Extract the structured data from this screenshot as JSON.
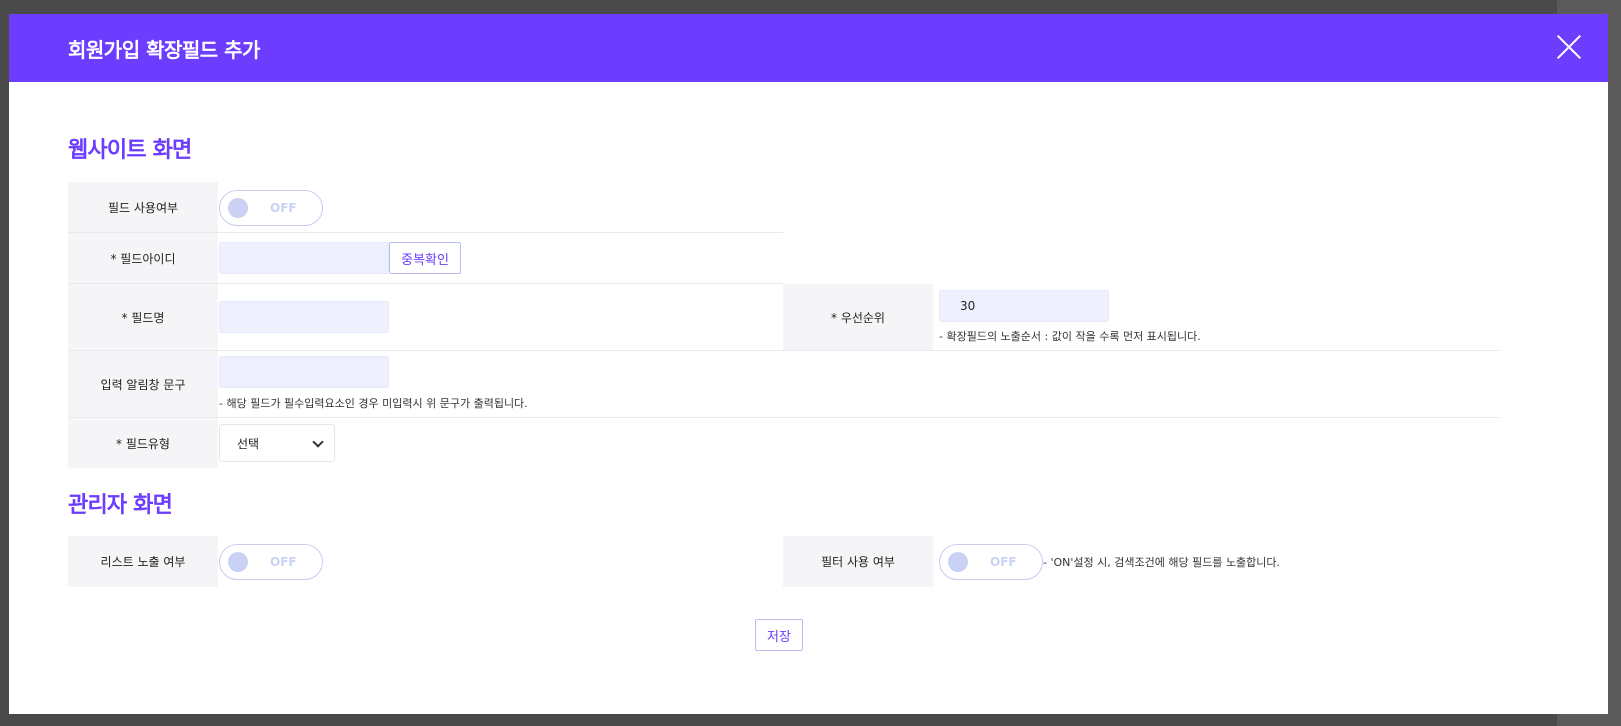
{
  "modal": {
    "title": "회원가입 확장필드 추가"
  },
  "website_section": {
    "title": "웹사이트 화면",
    "field_use": {
      "label": "필드 사용여부",
      "toggle": "OFF"
    },
    "field_id": {
      "label": "* 필드아이디",
      "value": "",
      "check_button": "중복확인"
    },
    "field_name": {
      "label": "* 필드명",
      "value": ""
    },
    "priority": {
      "label": "* 우선순위",
      "value": "30",
      "hint": "- 확장필드의 노출순서 : 값이 작을 수록 먼저 표시됩니다."
    },
    "alert_text": {
      "label": "입력 알림창 문구",
      "value": "",
      "hint": "- 해당 필드가 필수입력요소인 경우 미입력시 위 문구가 출력됩니다."
    },
    "field_type": {
      "label": "* 필드유형",
      "selected": "선택"
    }
  },
  "admin_section": {
    "title": "관리자 화면",
    "list_display": {
      "label": "리스트 노출 여부",
      "toggle": "OFF"
    },
    "filter_use": {
      "label": "필터 사용 여부",
      "toggle": "OFF",
      "hint": "- 'ON'설정 시, 검색조건에 해당 필드를 노출합니다."
    }
  },
  "actions": {
    "save": "저장"
  },
  "colors": {
    "accent": "#6c3cff",
    "input_bg": "#eef1fd",
    "label_bg": "#f5f5f8",
    "toggle_off": "#c9d2f5"
  },
  "icons": {
    "close": "close-icon",
    "select_arrow": "chevron-down-icon"
  }
}
